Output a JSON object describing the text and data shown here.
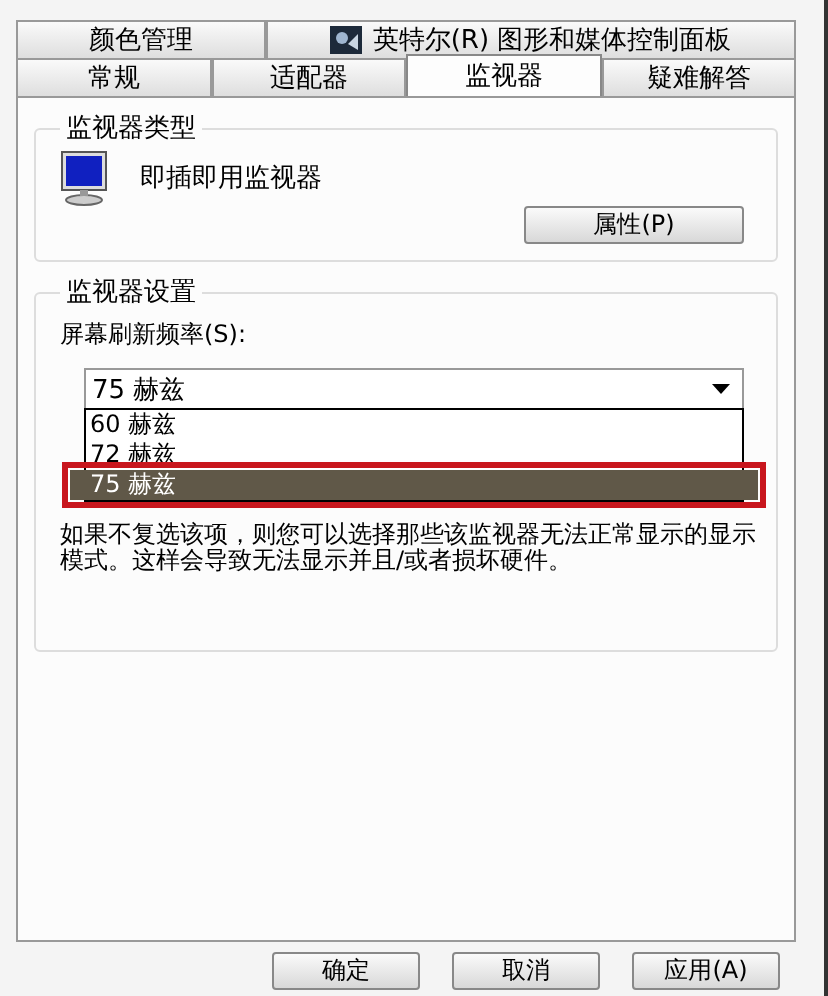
{
  "tabs_back": [
    {
      "label": "颜色管理",
      "icon": false,
      "selected": false
    },
    {
      "label": "英特尔(R) 图形和媒体控制面板",
      "icon": true,
      "selected": false
    }
  ],
  "tabs_front": [
    {
      "label": "常规",
      "selected": false
    },
    {
      "label": "适配器",
      "selected": false
    },
    {
      "label": "监视器",
      "selected": true
    },
    {
      "label": "疑难解答",
      "selected": false
    }
  ],
  "monitor_type": {
    "title": "监视器类型",
    "name": "即插即用监视器",
    "button": "属性(P)"
  },
  "monitor_settings": {
    "title": "监视器设置",
    "refresh_label": "屏幕刷新频率(S):",
    "refresh_value": "75 赫兹",
    "expanded": true,
    "options": [
      {
        "label": "60 赫兹",
        "selected": false
      },
      {
        "label": "72 赫兹",
        "selected": false
      },
      {
        "label": "75 赫兹",
        "selected": true
      }
    ],
    "note": "如果不复选该项，则您可以选择那些该监视器无法正常显示的显示模式。这样会导致无法显示并且/或者损坏硬件。"
  },
  "buttons": [
    "确定",
    "取消",
    "应用(A)"
  ]
}
